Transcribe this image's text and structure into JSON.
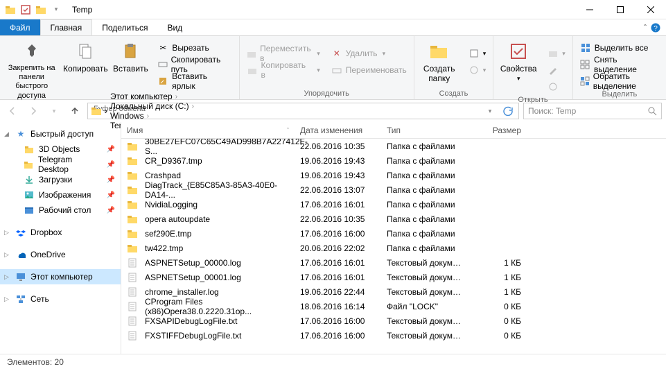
{
  "window": {
    "title": "Temp"
  },
  "tabs": {
    "file": "Файл",
    "home": "Главная",
    "share": "Поделиться",
    "view": "Вид"
  },
  "ribbon": {
    "clipboard": {
      "pin": "Закрепить на панели быстрого доступа",
      "copy": "Копировать",
      "paste": "Вставить",
      "cut": "Вырезать",
      "copypath": "Скопировать путь",
      "pasteshortcut": "Вставить ярлык",
      "label": "Буфер обмена"
    },
    "organize": {
      "moveto": "Переместить в",
      "copyto": "Копировать в",
      "delete": "Удалить",
      "rename": "Переименовать",
      "label": "Упорядочить"
    },
    "new": {
      "newfolder": "Создать папку",
      "newitem": "",
      "label": "Создать"
    },
    "open": {
      "properties": "Свойства",
      "label": "Открыть"
    },
    "select": {
      "selectall": "Выделить все",
      "selectnone": "Снять выделение",
      "invert": "Обратить выделение",
      "label": "Выделить"
    }
  },
  "breadcrumbs": [
    "Этот компьютер",
    "Локальный диск (C:)",
    "Windows",
    "Temp"
  ],
  "search": {
    "placeholder": "Поиск: Temp"
  },
  "sidebar": {
    "quick": "Быстрый доступ",
    "items": [
      "3D Objects",
      "Telegram Desktop",
      "Загрузки",
      "Изображения",
      "Рабочий стол"
    ],
    "dropbox": "Dropbox",
    "onedrive": "OneDrive",
    "thispc": "Этот компьютер",
    "network": "Сеть"
  },
  "columns": {
    "name": "Имя",
    "date": "Дата изменения",
    "type": "Тип",
    "size": "Размер"
  },
  "files": [
    {
      "icon": "folder",
      "name": "30BE27EFC07C65C49AD998B7A227412F-S...",
      "date": "22.06.2016 10:35",
      "type": "Папка с файлами",
      "size": ""
    },
    {
      "icon": "folder",
      "name": "CR_D9367.tmp",
      "date": "19.06.2016 19:43",
      "type": "Папка с файлами",
      "size": ""
    },
    {
      "icon": "folder",
      "name": "Crashpad",
      "date": "19.06.2016 19:43",
      "type": "Папка с файлами",
      "size": ""
    },
    {
      "icon": "folder",
      "name": "DiagTrack_{E85C85A3-85A3-40E0-DA14-...",
      "date": "22.06.2016 13:07",
      "type": "Папка с файлами",
      "size": ""
    },
    {
      "icon": "folder",
      "name": "NvidiaLogging",
      "date": "17.06.2016 16:01",
      "type": "Папка с файлами",
      "size": ""
    },
    {
      "icon": "folder",
      "name": "opera autoupdate",
      "date": "22.06.2016 10:35",
      "type": "Папка с файлами",
      "size": ""
    },
    {
      "icon": "folder",
      "name": "sef290E.tmp",
      "date": "17.06.2016 16:00",
      "type": "Папка с файлами",
      "size": ""
    },
    {
      "icon": "folder",
      "name": "tw422.tmp",
      "date": "20.06.2016 22:02",
      "type": "Папка с файлами",
      "size": ""
    },
    {
      "icon": "file",
      "name": "ASPNETSetup_00000.log",
      "date": "17.06.2016 16:01",
      "type": "Текстовый докум…",
      "size": "1 КБ"
    },
    {
      "icon": "file",
      "name": "ASPNETSetup_00001.log",
      "date": "17.06.2016 16:01",
      "type": "Текстовый докум…",
      "size": "1 КБ"
    },
    {
      "icon": "file",
      "name": "chrome_installer.log",
      "date": "19.06.2016 22:44",
      "type": "Текстовый докум…",
      "size": "1 КБ"
    },
    {
      "icon": "file",
      "name": "CProgram Files (x86)Opera38.0.2220.31op...",
      "date": "18.06.2016 16:14",
      "type": "Файл \"LOCK\"",
      "size": "0 КБ"
    },
    {
      "icon": "file",
      "name": "FXSAPIDebugLogFile.txt",
      "date": "17.06.2016 16:00",
      "type": "Текстовый докум…",
      "size": "0 КБ"
    },
    {
      "icon": "file",
      "name": "FXSTIFFDebugLogFile.txt",
      "date": "17.06.2016 16:00",
      "type": "Текстовый докум…",
      "size": "0 КБ"
    }
  ],
  "status": {
    "count": "Элементов: 20"
  }
}
